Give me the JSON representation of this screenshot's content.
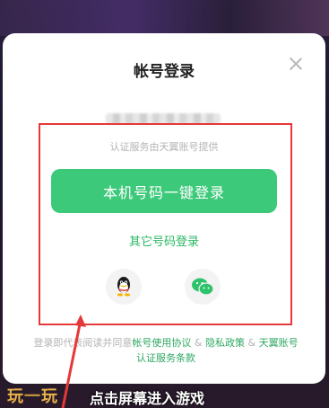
{
  "dialog": {
    "title": "帐号登录",
    "provider_text": "认证服务由天翼账号提供",
    "primary_button": "本机号码一键登录",
    "other_login": "其它号码登录",
    "social": [
      {
        "name": "qq",
        "icon": "qq-penguin-icon"
      },
      {
        "name": "wechat",
        "icon": "wechat-icon"
      }
    ],
    "agreement": {
      "prefix": "登录即代表阅读并同意",
      "link1": "帐号使用协议",
      "sep1": " & ",
      "link2": "隐私政策",
      "sep2": " & ",
      "link3": "天翼账号认证服务条款"
    }
  },
  "footer": {
    "watermark_a": "玩",
    "watermark_b": "一",
    "watermark_c": "玩",
    "tap_hint": "点击屏幕进入游戏"
  },
  "colors": {
    "accent_green": "#3dc97a",
    "link_green": "#27b864",
    "annotation_red": "#e53838"
  }
}
